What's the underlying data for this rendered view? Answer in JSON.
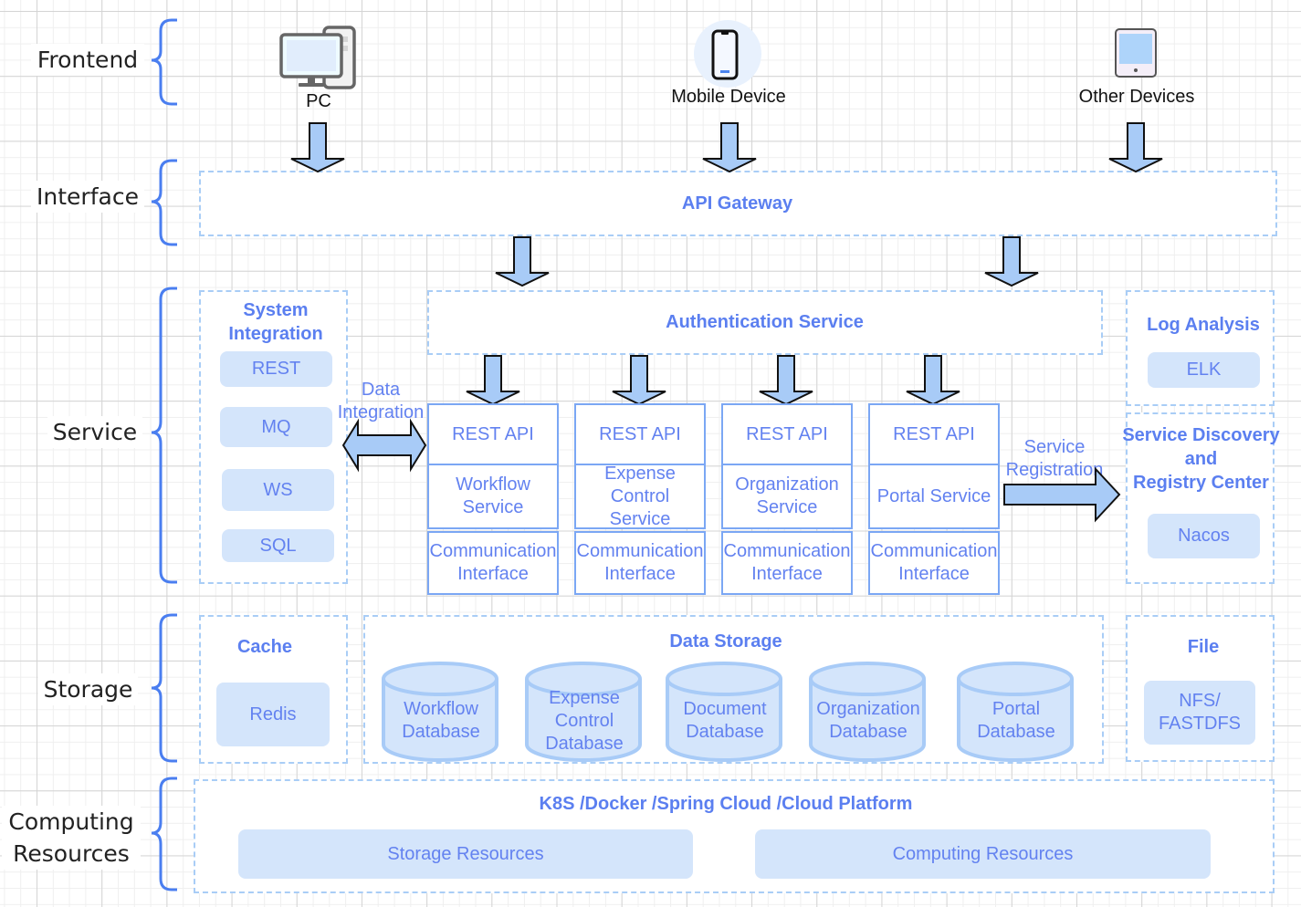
{
  "layers": {
    "frontend": "Frontend",
    "interface": "Interface",
    "service": "Service",
    "storage": "Storage",
    "computing": "Computing\nResources"
  },
  "frontend": {
    "devices": [
      {
        "label": "PC",
        "icon": "desktop-computer-icon"
      },
      {
        "label": "Mobile Device",
        "icon": "smartphone-icon"
      },
      {
        "label": "Other Devices",
        "icon": "tablet-icon"
      }
    ]
  },
  "interface": {
    "gateway": "API Gateway"
  },
  "service": {
    "system_integration": {
      "title": "System\nIntegration",
      "items": [
        "REST",
        "MQ",
        "WS",
        "SQL"
      ]
    },
    "data_integration_label": "Data\nIntegration",
    "authentication": "Authentication Service",
    "columns": [
      {
        "api": "REST API",
        "service": "Workflow\nService",
        "comm": "Communication\nInterface"
      },
      {
        "api": "REST API",
        "service": "Expense\nControl\nService",
        "comm": "Communication\nInterface"
      },
      {
        "api": "REST API",
        "service": "Organization\nService",
        "comm": "Communication\nInterface"
      },
      {
        "api": "REST API",
        "service": "Portal Service",
        "comm": "Communication\nInterface"
      }
    ],
    "service_registration_label": "Service\nRegistration",
    "log_analysis": {
      "title": "Log Analysis",
      "item": "ELK"
    },
    "registry": {
      "title": "Service Discovery\nand\nRegistry Center",
      "item": "Nacos"
    }
  },
  "storage": {
    "cache": {
      "title": "Cache",
      "item": "Redis"
    },
    "data_storage": {
      "title": "Data Storage",
      "databases": [
        "Workflow\nDatabase",
        "Expense\nControl\nDatabase",
        "Document\nDatabase",
        "Organization\nDatabase",
        "Portal\nDatabase"
      ]
    },
    "file": {
      "title": "File",
      "item": "NFS/\nFASTDFS"
    }
  },
  "computing": {
    "title": "K8S /Docker /Spring Cloud /Cloud Platform",
    "items": [
      "Storage Resources",
      "Computing Resources"
    ]
  },
  "colors": {
    "accent_text": "#6382f0",
    "title_text": "#5b7ff0",
    "pill_fill": "#d4e5fb",
    "dashed_border": "#a9cdf6",
    "solid_border": "#7ba7f4",
    "arrow_fill": "#a8cbf7",
    "brace": "#4a7ef0"
  }
}
